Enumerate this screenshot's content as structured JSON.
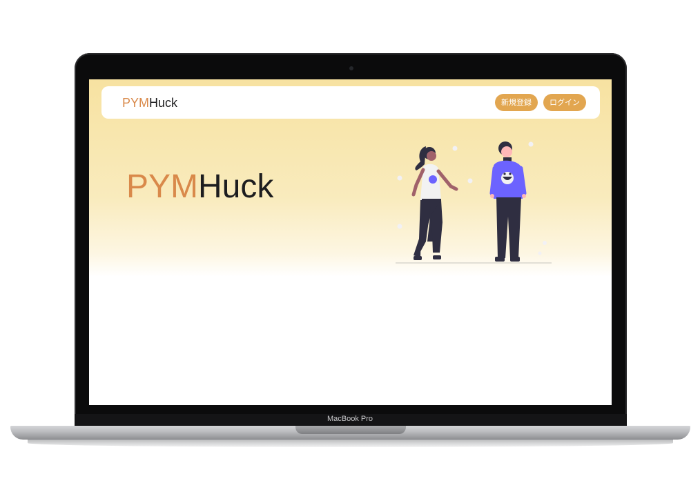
{
  "site": {
    "logo": {
      "part1": "PYM",
      "part2": "Huck"
    },
    "nav": {
      "signup_label": "新規登録",
      "login_label": "ログイン"
    },
    "hero": {
      "title_part1": "PYM",
      "title_part2": "Huck"
    }
  },
  "device": {
    "model_label": "MacBook Pro"
  },
  "colors": {
    "accent": "#d9894a",
    "button": "#e2a650",
    "hero_gradient_top": "#f7e2a1",
    "figure_shirt": "#6c63ff"
  },
  "icons": {
    "illustration": "two-people-illustration"
  }
}
